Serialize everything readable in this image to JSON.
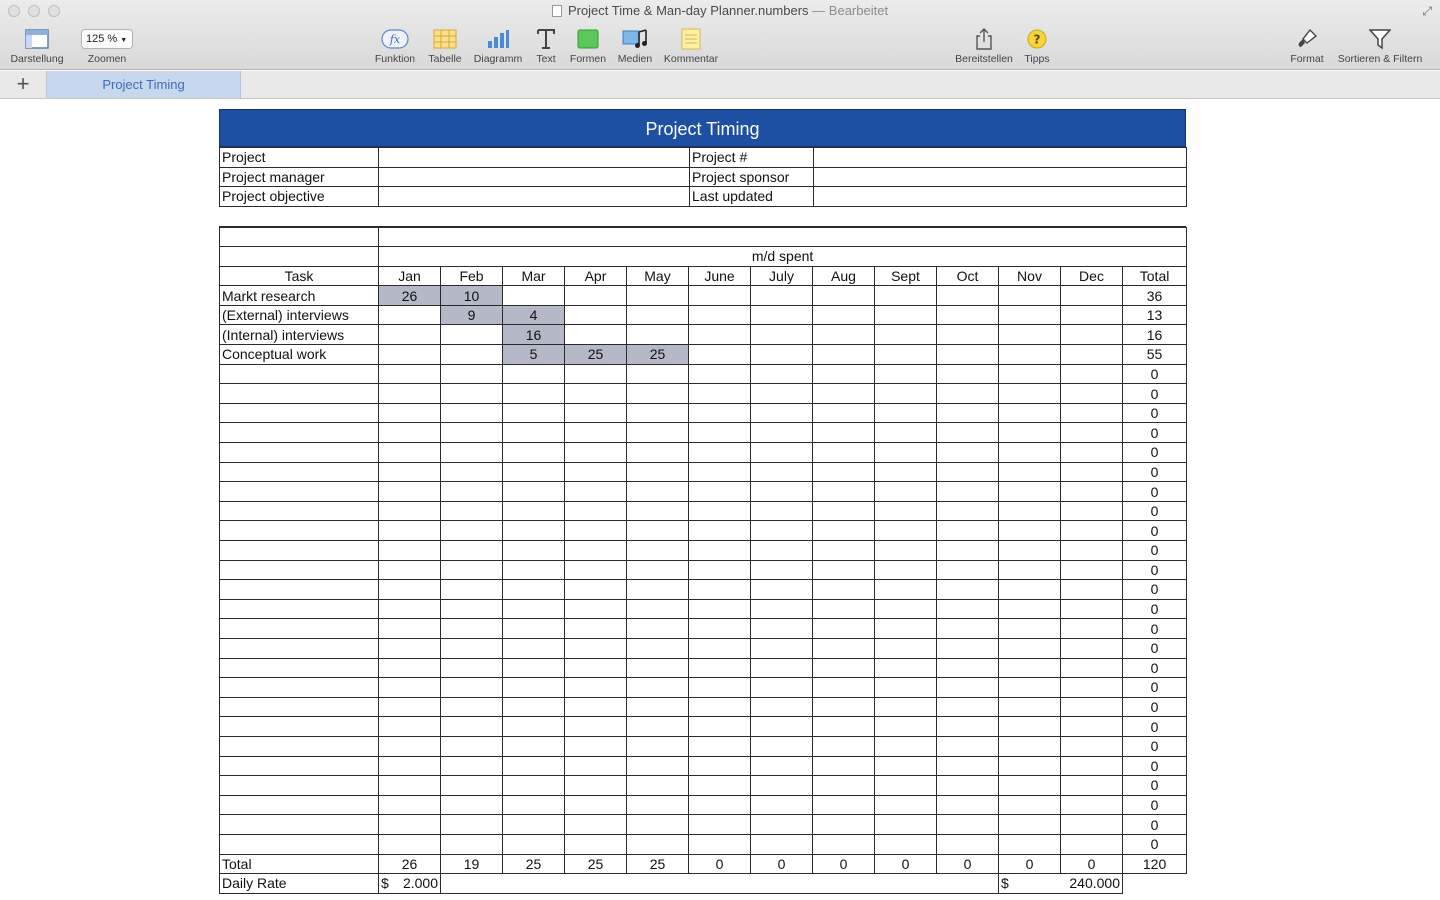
{
  "window": {
    "title": "Project Time & Man-day Planner.numbers",
    "separator": "—",
    "status": "Bearbeitet"
  },
  "toolbar": {
    "view_label": "Darstellung",
    "zoom_value": "125 %",
    "zoom_label": "Zoomen",
    "function_label": "Funktion",
    "table_label": "Tabelle",
    "chart_label": "Diagramm",
    "text_label": "Text",
    "shapes_label": "Formen",
    "media_label": "Medien",
    "comment_label": "Kommentar",
    "share_label": "Bereitstellen",
    "tips_label": "Tipps",
    "format_label": "Format",
    "sort_filter_label": "Sortieren & Filtern",
    "fx_text": "fx",
    "tips_glyph": "?"
  },
  "sheet_tabs": {
    "add_glyph": "+",
    "active": "Project Timing"
  },
  "colors": {
    "banner": "#1d4fa2",
    "shaded_cell": "#b5b8c7",
    "tab_active": "#c7d7ee",
    "tab_text": "#3c6db3"
  },
  "table": {
    "title": "Project Timing",
    "info": [
      {
        "label_left": "Project",
        "value_left": "",
        "label_right": "Project #",
        "value_right": ""
      },
      {
        "label_left": "Project manager",
        "value_left": "",
        "label_right": "Project sponsor",
        "value_right": ""
      },
      {
        "label_left": "Project objective",
        "value_left": "",
        "label_right": "Last updated",
        "value_right": ""
      }
    ],
    "group_header": "m/d spent",
    "task_header": "Task",
    "months": [
      "Jan",
      "Feb",
      "Mar",
      "Apr",
      "May",
      "June",
      "July",
      "Aug",
      "Sept",
      "Oct",
      "Nov",
      "Dec"
    ],
    "total_header": "Total",
    "rows": [
      {
        "task": "Markt research",
        "cells": [
          "26",
          "10",
          "",
          "",
          "",
          "",
          "",
          "",
          "",
          "",
          "",
          ""
        ],
        "shaded": [
          0,
          1
        ],
        "total": "36"
      },
      {
        "task": "(External) interviews",
        "cells": [
          "",
          "9",
          "4",
          "",
          "",
          "",
          "",
          "",
          "",
          "",
          "",
          ""
        ],
        "shaded": [
          1,
          2
        ],
        "total": "13"
      },
      {
        "task": "(Internal) interviews",
        "cells": [
          "",
          "",
          "16",
          "",
          "",
          "",
          "",
          "",
          "",
          "",
          "",
          ""
        ],
        "shaded": [
          2
        ],
        "total": "16"
      },
      {
        "task": "Conceptual work",
        "cells": [
          "",
          "",
          "5",
          "25",
          "25",
          "",
          "",
          "",
          "",
          "",
          "",
          ""
        ],
        "shaded": [
          2,
          3,
          4
        ],
        "total": "55"
      }
    ],
    "empty_row_total": "0",
    "empty_row_count": 25,
    "total_row": {
      "label": "Total",
      "months": [
        "26",
        "19",
        "25",
        "25",
        "25",
        "0",
        "0",
        "0",
        "0",
        "0",
        "0",
        "0"
      ],
      "total": "120"
    },
    "daily_rate": {
      "label": "Daily Rate",
      "currency": "$",
      "rate": "2.000",
      "total_currency": "$",
      "total": "240.000"
    }
  }
}
